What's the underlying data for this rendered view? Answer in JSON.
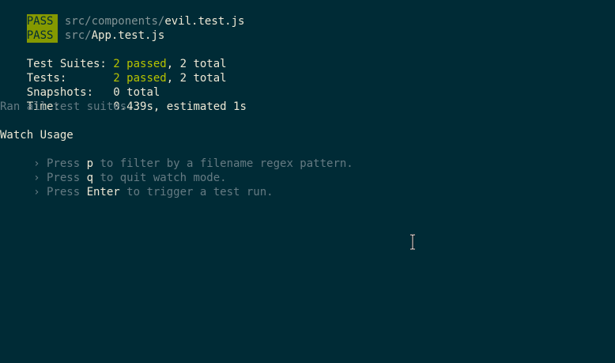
{
  "results": [
    {
      "status": "PASS",
      "dir": "src/components/",
      "file": "evil.test.js"
    },
    {
      "status": "PASS",
      "dir": "src/",
      "file": "App.test.js"
    }
  ],
  "summary": {
    "suites_label": "Test Suites: ",
    "suites_passed": "2 passed",
    "suites_total": ", 2 total",
    "tests_label": "Tests:       ",
    "tests_passed": "2 passed",
    "tests_total": ", 2 total",
    "snapshots_label": "Snapshots:   ",
    "snapshots_value": "0 total",
    "time_label": "Time:        ",
    "time_value": "0.439s, estimated 1s",
    "ran_all": "Ran all test suites."
  },
  "watch": {
    "title": "Watch Usage",
    "items": [
      {
        "prefix": " › Press ",
        "key": "p",
        "suffix": " to filter by a filename regex pattern."
      },
      {
        "prefix": " › Press ",
        "key": "q",
        "suffix": " to quit watch mode."
      },
      {
        "prefix": " › Press ",
        "key": "Enter",
        "suffix": " to trigger a test run."
      }
    ]
  },
  "colors": {
    "background": "#002b36",
    "pass_badge": "#859900",
    "passed_text": "#b7c300"
  },
  "cursor": {
    "icon": "text-cursor-icon"
  }
}
